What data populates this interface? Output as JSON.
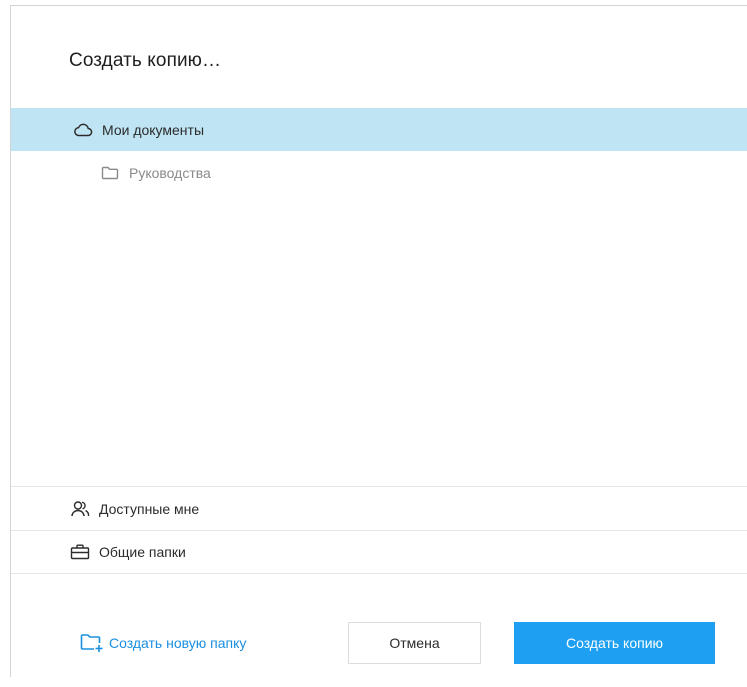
{
  "dialog": {
    "title": "Создать копию…"
  },
  "tree": {
    "root": {
      "label": "Мои документы",
      "icon": "cloud-icon",
      "selected": true
    },
    "children": [
      {
        "label": "Руководства",
        "icon": "folder-icon"
      }
    ]
  },
  "sections": [
    {
      "label": "Доступные мне",
      "icon": "users-icon"
    },
    {
      "label": "Общие папки",
      "icon": "briefcase-icon"
    }
  ],
  "footer": {
    "new_folder_label": "Создать новую папку",
    "cancel_label": "Отмена",
    "submit_label": "Создать копию"
  },
  "colors": {
    "accent": "#1e9ff2",
    "selection": "#bfe5f4",
    "link": "#1a8fe0"
  }
}
